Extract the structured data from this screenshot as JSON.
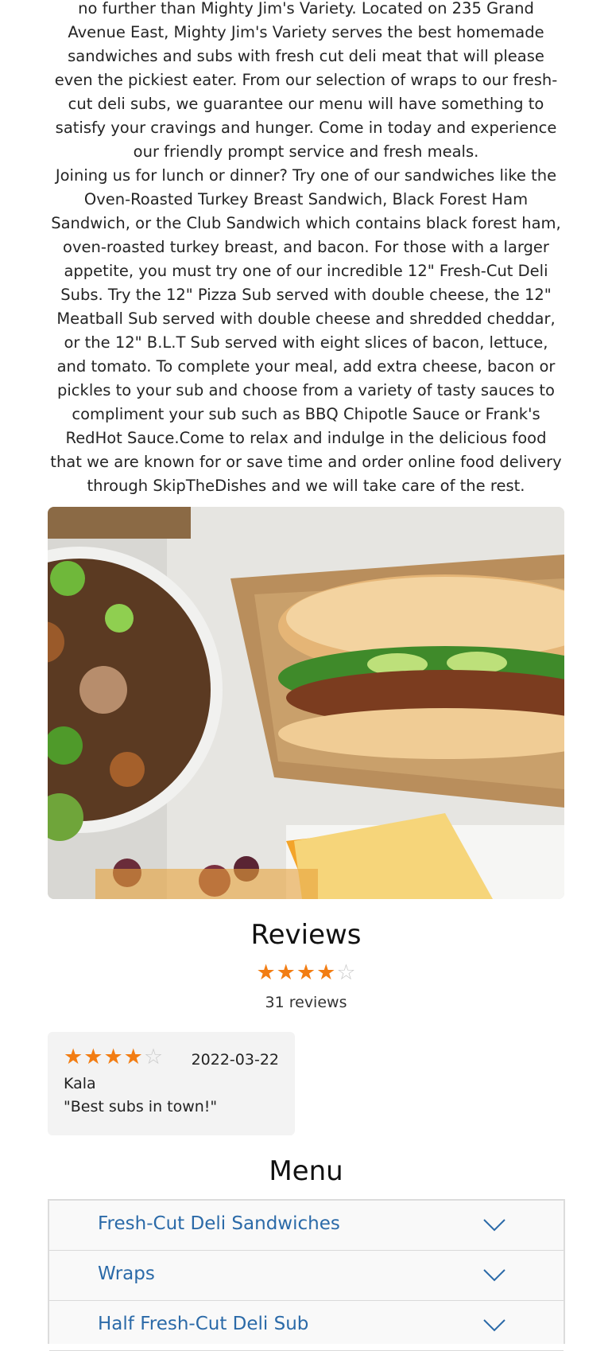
{
  "about": {
    "paragraphs": [
      "no further than Mighty Jim's Variety. Located on 235 Grand Avenue East, Mighty Jim's Variety serves the best homemade sandwiches and subs with fresh cut deli meat that will please even the pickiest eater. From our selection of wraps to our fresh-cut deli subs, we guarantee our menu will have something to satisfy your cravings and hunger. Come in today and experience our friendly prompt service and fresh meals.",
      "Joining us for lunch or dinner? Try one of our sandwiches like the Oven-Roasted Turkey Breast Sandwich, Black Forest Ham Sandwich, or the Club Sandwich which contains black forest ham, oven-roasted turkey breast, and bacon. For those with a larger appetite, you must try one of our incredible 12\" Fresh-Cut Deli Subs. Try the 12\" Pizza Sub served with double cheese, the 12\" Meatball Sub served with double cheese and shredded cheddar, or the 12\" B.L.T Sub served with eight slices of bacon, lettuce, and tomato. To complete your meal, add extra cheese, bacon or pickles to your sub and choose from a variety of tasty sauces to compliment your sub such as BBQ Chipotle Sauce or Frank's RedHot Sauce.Come to relax and indulge in the delicious food that we are known for or save time and order online food delivery through SkipTheDishes and we will take care of the rest."
    ]
  },
  "reviews": {
    "title": "Reviews",
    "average_rating": 4,
    "max_rating": 5,
    "count_text": "31 reviews",
    "items": [
      {
        "rating": 4,
        "date": "2022-03-22",
        "author": "Kala",
        "text": "\"Best subs in town!\""
      }
    ]
  },
  "menu": {
    "title": "Menu",
    "categories": [
      "Fresh-Cut Deli Sandwiches",
      "Wraps",
      "Half Fresh-Cut Deli Sub"
    ]
  },
  "colors": {
    "star": "#f27d13",
    "menu_link": "#2b6aa8"
  },
  "icons": {
    "star": "star-icon",
    "expand": "chevron-down-icon"
  }
}
